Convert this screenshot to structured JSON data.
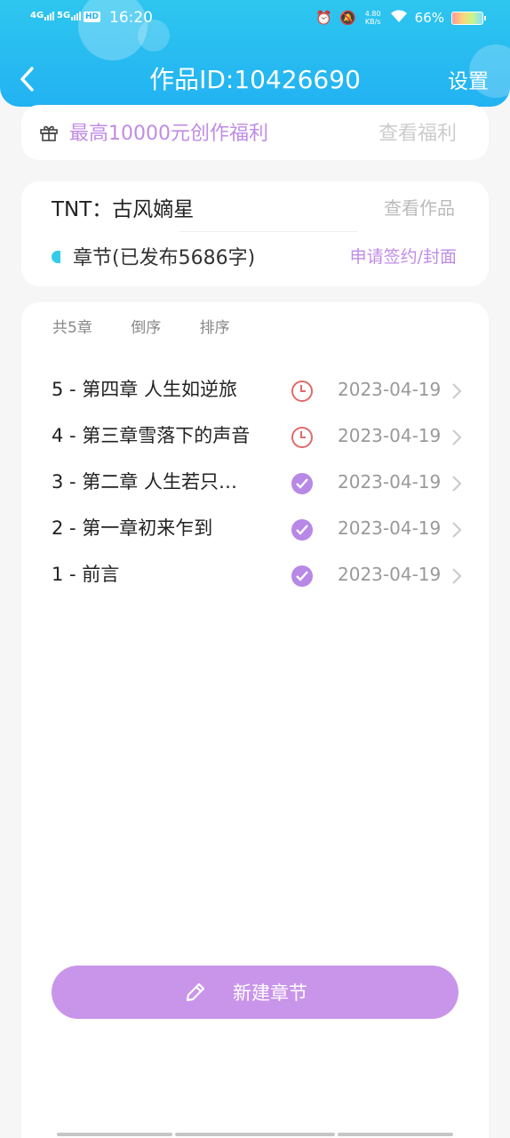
{
  "status_bar": {
    "network1": "4G",
    "network2": "5G",
    "hd": "HD",
    "time": "16:20",
    "speed": "4.80 KB/s",
    "battery": "66%"
  },
  "header": {
    "title": "作品ID:10426690",
    "settings_label": "设置"
  },
  "benefit": {
    "text": "最高10000元创作福利",
    "link": "查看福利"
  },
  "work": {
    "name": "TNT：古风嫡星",
    "view_link": "查看作品",
    "chapters_label": "章节(已发布5686字)",
    "sign_link": "申请签约/封面"
  },
  "toolbar": {
    "count": "共5章",
    "reverse": "倒序",
    "sort": "排序"
  },
  "chapters": [
    {
      "title": "5 - 第四章 人生如逆旅",
      "status": "pending",
      "date": "2023-04-19"
    },
    {
      "title": "4 - 第三章雪落下的声音",
      "status": "pending",
      "date": "2023-04-19"
    },
    {
      "title": "3 - 第二章 人生若只…",
      "status": "done",
      "date": "2023-04-19"
    },
    {
      "title": "2 - 第一章初来乍到",
      "status": "done",
      "date": "2023-04-19"
    },
    {
      "title": "1 - 前言",
      "status": "done",
      "date": "2023-04-19"
    }
  ],
  "new_chapter_button": "新建章节",
  "colors": {
    "header": "#22b2f2",
    "accent": "#c995ea",
    "pending": "#e06a6a",
    "done": "#b788e6"
  }
}
